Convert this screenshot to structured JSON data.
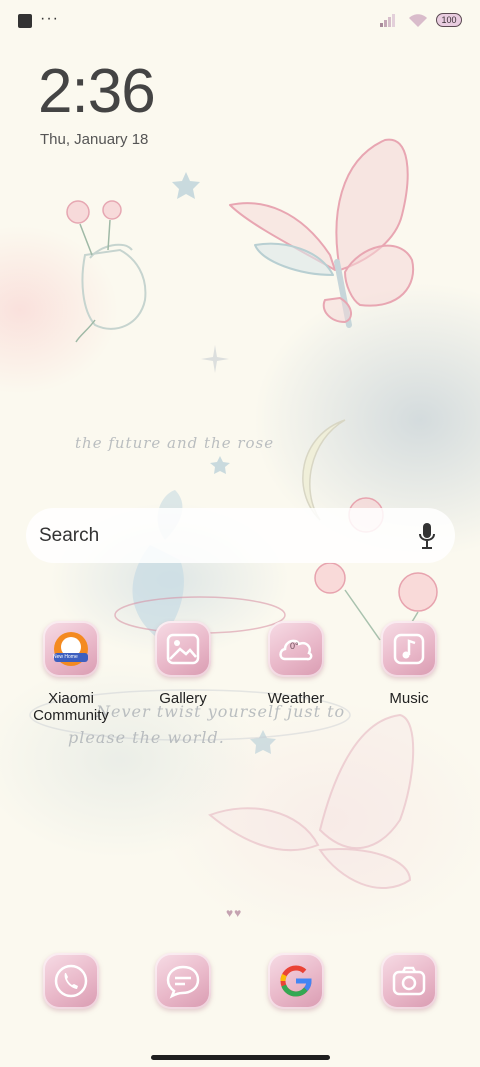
{
  "status_bar": {
    "battery": "100",
    "icons": [
      "notification-square-icon",
      "more-dots-icon",
      "signal-icon",
      "wifi-icon",
      "battery-icon"
    ]
  },
  "clock": {
    "time": "2:36",
    "date": "Thu, January 18"
  },
  "wallpaper": {
    "texts": [
      "the future and the rose",
      "Never twist yourself just to",
      "please the world."
    ]
  },
  "search": {
    "label": "Search"
  },
  "apps": [
    {
      "label": "Xiaomi Community",
      "icon": "xiaomi-community-icon",
      "badge": "New Home"
    },
    {
      "label": "Gallery",
      "icon": "gallery-icon"
    },
    {
      "label": "Weather",
      "icon": "weather-cloud-icon",
      "value": "0°"
    },
    {
      "label": "Music",
      "icon": "music-note-icon"
    }
  ],
  "dock": [
    {
      "icon": "phone-icon"
    },
    {
      "icon": "messages-icon"
    },
    {
      "icon": "google-icon"
    },
    {
      "icon": "camera-icon"
    }
  ],
  "colors": {
    "icon_pink": "#e9b8c9",
    "background": "#fbf9ef",
    "text": "#222222"
  }
}
